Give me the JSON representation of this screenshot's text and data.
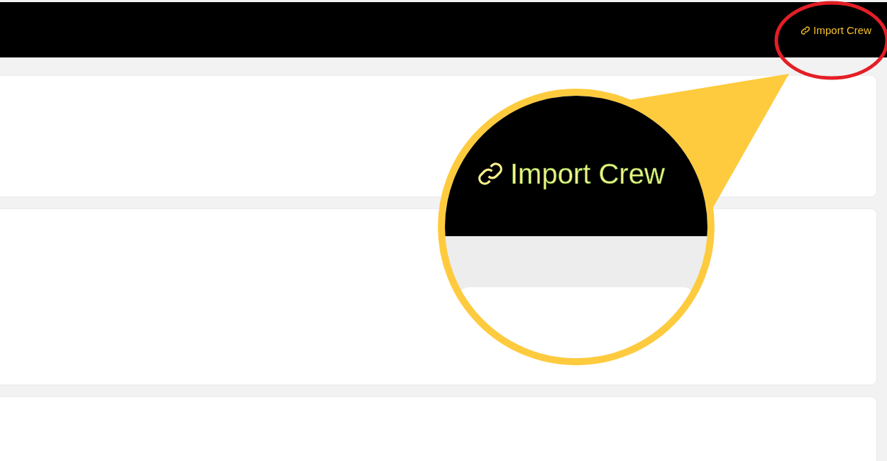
{
  "navbar": {
    "link": {
      "label": "Import Crew"
    }
  },
  "magnifier": {
    "label": "Import Crew"
  }
}
